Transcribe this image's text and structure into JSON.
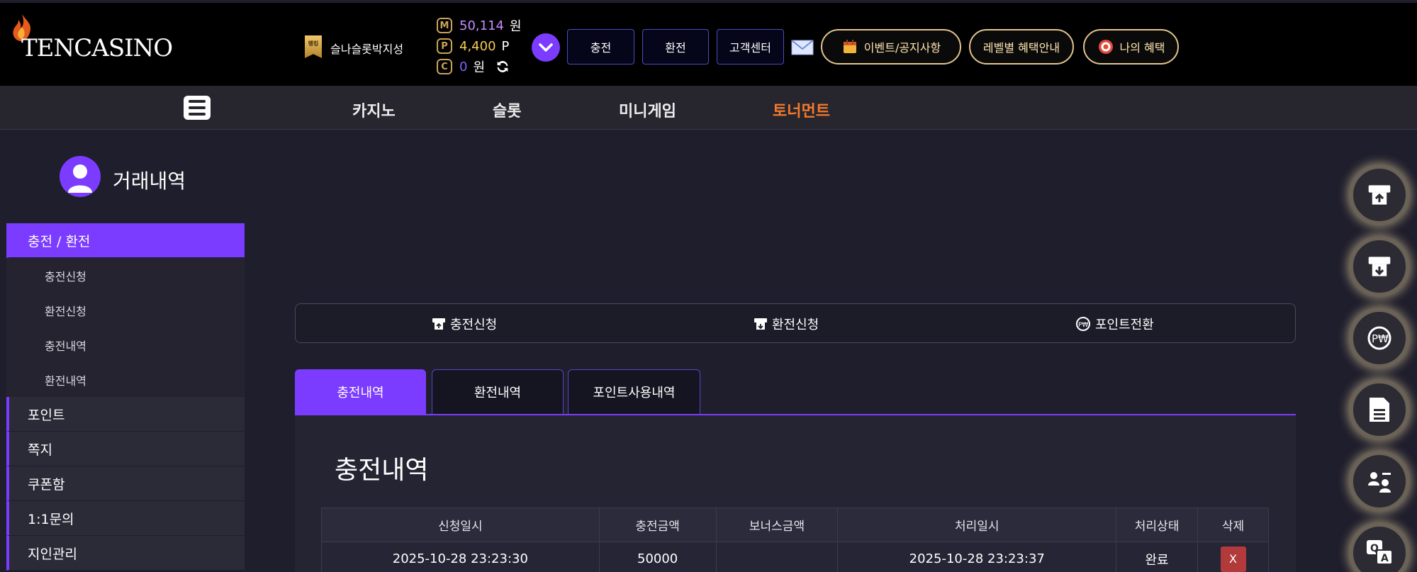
{
  "header": {
    "brand": "TENCASINO",
    "username": "슬나슬롯박지성",
    "badge_text": "랭킹",
    "balances": [
      {
        "coin": "M",
        "value": "50,114",
        "unit": "원"
      },
      {
        "coin": "P",
        "value": "4,400",
        "unit": "P"
      },
      {
        "coin": "C",
        "value": "0",
        "unit": "원"
      }
    ],
    "buttons": [
      "충전",
      "환전",
      "고객센터"
    ],
    "pills": [
      "이벤트/공지사항",
      "레벨별 혜택안내",
      "나의 혜택"
    ]
  },
  "nav": {
    "items": [
      "카지노",
      "슬롯",
      "미니게임",
      "토너먼트"
    ],
    "active": "토너먼트"
  },
  "sidebar": {
    "title": "거래내역",
    "active_main": "충전 / 환전",
    "subitems": [
      "충전신청",
      "환전신청",
      "충전내역",
      "환전내역"
    ],
    "mains": [
      "포인트",
      "쪽지",
      "쿠폰함",
      "1:1문의",
      "지인관리"
    ]
  },
  "quick": [
    "충전신청",
    "환전신청",
    "포인트전환"
  ],
  "tabs": [
    "충전내역",
    "환전내역",
    "포인트사용내역"
  ],
  "section_title": "충전내역",
  "table": {
    "headers": [
      "신청일시",
      "충전금액",
      "보너스금액",
      "처리일시",
      "처리상태",
      "삭제"
    ],
    "rows": [
      {
        "requested": "2025-10-28 23:23:30",
        "amount": "50000",
        "bonus": "",
        "processed": "2025-10-28 23:23:37",
        "status": "완료",
        "delete": "X"
      }
    ]
  },
  "colors": {
    "accent": "#7b3cff",
    "nav_active": "#f47a2c",
    "delete": "#b23a3a",
    "pill_border": "#e3c48e"
  }
}
